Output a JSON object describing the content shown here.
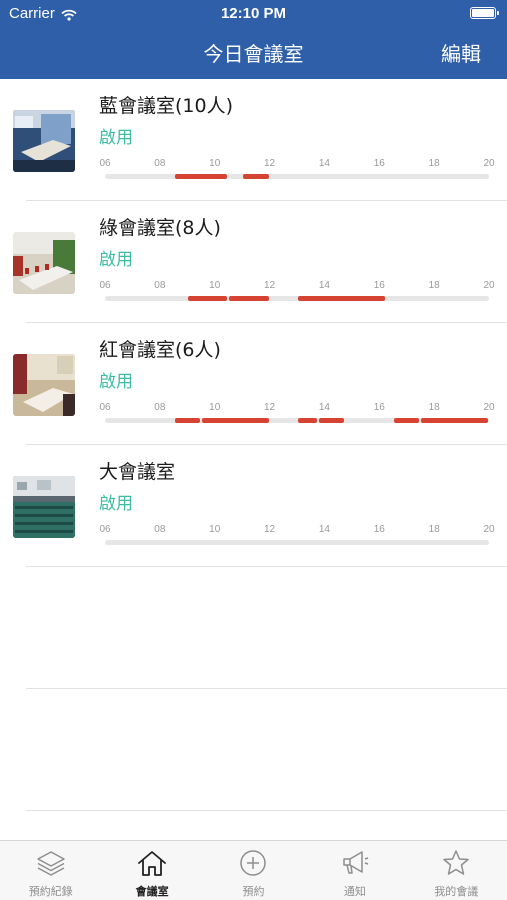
{
  "status_bar": {
    "carrier": "Carrier",
    "time": "12:10 PM"
  },
  "nav": {
    "title": "今日會議室",
    "edit_label": "編輯"
  },
  "timeline_ticks": [
    "06",
    "08",
    "10",
    "12",
    "14",
    "16",
    "18",
    "20"
  ],
  "timeline_range_hours": [
    6,
    20
  ],
  "colors": {
    "header": "#2e5fa8",
    "status_text": "#3dbba3",
    "booked": "#d74333",
    "track": "#e6e6e6"
  },
  "rooms": [
    {
      "name": "藍會議室(10人)",
      "status": "啟用",
      "thumb": "blue-room-photo",
      "bookings": [
        [
          8.5,
          10.5
        ],
        [
          11,
          12
        ]
      ]
    },
    {
      "name": "綠會議室(8人)",
      "status": "啟用",
      "thumb": "green-room-photo",
      "bookings": [
        [
          9,
          10.5
        ],
        [
          10.5,
          12
        ],
        [
          13,
          16.25
        ]
      ]
    },
    {
      "name": "紅會議室(6人)",
      "status": "啟用",
      "thumb": "red-room-photo",
      "bookings": [
        [
          8.5,
          9.5
        ],
        [
          9.5,
          12
        ],
        [
          13,
          13.75
        ],
        [
          13.75,
          14.75
        ],
        [
          16.5,
          17.5
        ],
        [
          17.5,
          20
        ]
      ]
    },
    {
      "name": "大會議室",
      "status": "啟用",
      "thumb": "large-room-photo",
      "bookings": []
    }
  ],
  "tabs": [
    {
      "label": "預約紀錄",
      "icon": "layers-icon",
      "active": false
    },
    {
      "label": "會議室",
      "icon": "home-icon",
      "active": true
    },
    {
      "label": "預約",
      "icon": "plus-circle-icon",
      "active": false
    },
    {
      "label": "通知",
      "icon": "megaphone-icon",
      "active": false
    },
    {
      "label": "我的會議",
      "icon": "star-icon",
      "active": false
    }
  ]
}
